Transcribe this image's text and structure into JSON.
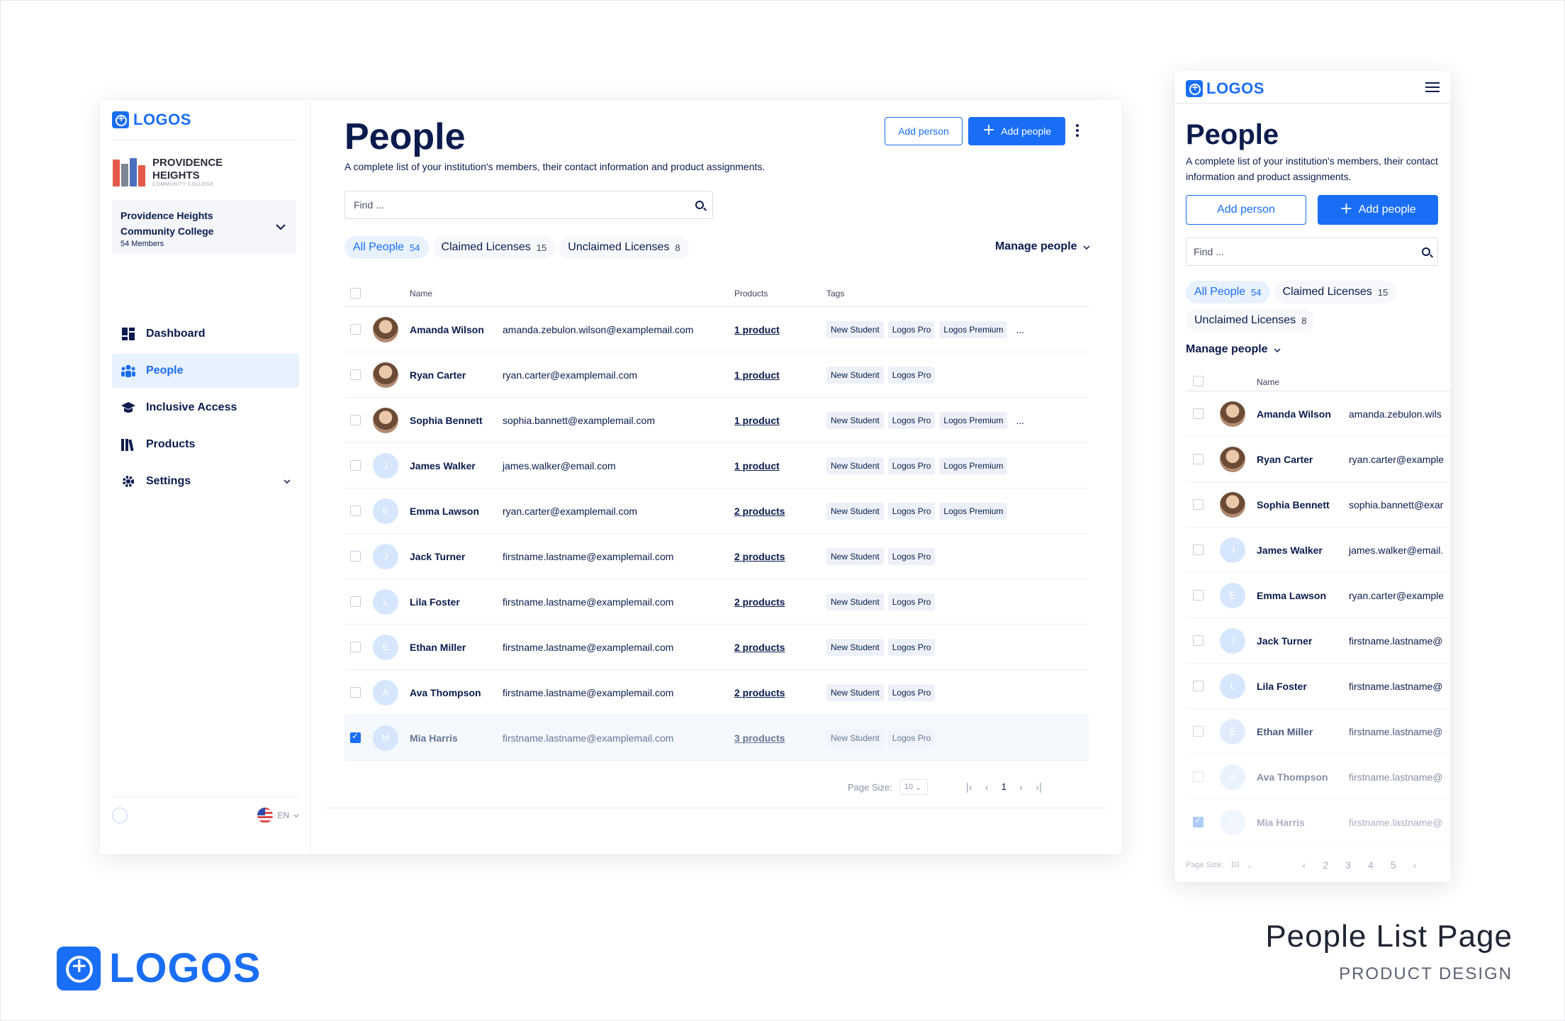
{
  "brand": {
    "logo_text": "LOGOS",
    "accent": "#1a6ef5",
    "navy": "#0b1b4d"
  },
  "institution": {
    "name_line1": "PROVIDENCE",
    "name_line2": "HEIGHTS",
    "sub": "COMMUNITY COLLEGE"
  },
  "org": {
    "title": "Providence Heights Community College",
    "members": "54 Members"
  },
  "nav": [
    {
      "label": "Dashboard",
      "icon": "dashboard-icon"
    },
    {
      "label": "People",
      "icon": "people-icon",
      "active": true
    },
    {
      "label": "Inclusive Access",
      "icon": "graduation-cap-icon"
    },
    {
      "label": "Products",
      "icon": "books-icon"
    },
    {
      "label": "Settings",
      "icon": "gear-icon"
    }
  ],
  "footer": {
    "lang": "EN"
  },
  "header": {
    "title": "People",
    "description": "A complete list of your institution's members, their contact information and product assignments.",
    "add_person": "Add person",
    "add_people": "Add people"
  },
  "search": {
    "placeholder": "Find ..."
  },
  "tabs": [
    {
      "label": "All People",
      "count": "54"
    },
    {
      "label": "Claimed Licenses",
      "count": "15"
    },
    {
      "label": "Unclaimed Licenses",
      "count": "8"
    }
  ],
  "manage_people": "Manage people",
  "columns": {
    "name": "Name",
    "products": "Products",
    "tags": "Tags"
  },
  "people": [
    {
      "name": "Amanda Wilson",
      "email": "amanda.zebulon.wilson@examplemail.com",
      "products": "1 product",
      "tags": [
        "New Student",
        "Logos Pro",
        "Logos Premium"
      ],
      "more": "...",
      "photo": true,
      "initial": ""
    },
    {
      "name": "Ryan Carter",
      "email": "ryan.carter@examplemail.com",
      "products": "1 product",
      "tags": [
        "New Student",
        "Logos Pro"
      ],
      "more": "",
      "photo": true,
      "initial": ""
    },
    {
      "name": "Sophia Bennett",
      "email": "sophia.bannett@examplemail.com",
      "products": "1 product",
      "tags": [
        "New Student",
        "Logos Pro",
        "Logos Premium"
      ],
      "more": "...",
      "photo": true,
      "initial": ""
    },
    {
      "name": "James Walker",
      "email": "james.walker@email.com",
      "products": "1 product",
      "tags": [
        "New Student",
        "Logos Pro",
        "Logos Premium"
      ],
      "more": "",
      "photo": false,
      "initial": "J"
    },
    {
      "name": "Emma Lawson",
      "email": "ryan.carter@examplemail.com",
      "products": "2 products",
      "tags": [
        "New Student",
        "Logos Pro",
        "Logos Premium"
      ],
      "more": "",
      "photo": false,
      "initial": "E"
    },
    {
      "name": "Jack Turner",
      "email": "firstname.lastname@examplemail.com",
      "products": "2 products",
      "tags": [
        "New Student",
        "Logos Pro"
      ],
      "more": "",
      "photo": false,
      "initial": "J"
    },
    {
      "name": "Lila Foster",
      "email": "firstname.lastname@examplemail.com",
      "products": "2 products",
      "tags": [
        "New Student",
        "Logos Pro"
      ],
      "more": "",
      "photo": false,
      "initial": "L"
    },
    {
      "name": "Ethan Miller",
      "email": "firstname.lastname@examplemail.com",
      "products": "2 products",
      "tags": [
        "New Student",
        "Logos Pro"
      ],
      "more": "",
      "photo": false,
      "initial": "E"
    },
    {
      "name": "Ava Thompson",
      "email": "firstname.lastname@examplemail.com",
      "products": "2 products",
      "tags": [
        "New Student",
        "Logos Pro"
      ],
      "more": "",
      "photo": false,
      "initial": "A"
    },
    {
      "name": "Mia Harris",
      "email": "firstname.lastname@examplemail.com",
      "products": "3 products",
      "tags": [
        "New Student",
        "Logos Pro"
      ],
      "more": "",
      "photo": false,
      "initial": "M",
      "checked": true
    }
  ],
  "mobile_emails": [
    "amanda.zebulon.wils",
    "ryan.carter@example",
    "sophia.bannett@exar",
    "james.walker@email.",
    "ryan.carter@example",
    "firstname.lastname@",
    "firstname.lastname@",
    "firstname.lastname@",
    "firstname.lastname@",
    "firstname.lastname@"
  ],
  "pager": {
    "size_label": "Page Size:",
    "size": "10",
    "current": "1",
    "mobile_pages": [
      "2",
      "3",
      "4",
      "5"
    ]
  },
  "caption": {
    "title": "People List Page",
    "subtitle": "PRODUCT DESIGN"
  }
}
